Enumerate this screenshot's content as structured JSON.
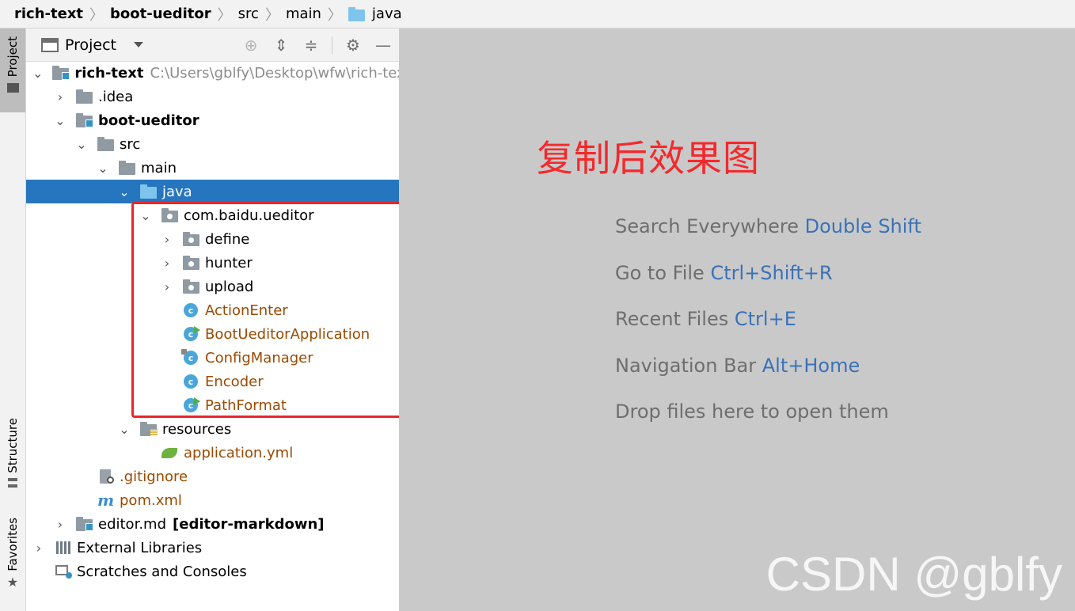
{
  "breadcrumb": {
    "items": [
      "rich-text",
      "boot-ueditor",
      "src",
      "main",
      "java"
    ]
  },
  "toolstrip": {
    "project_label": "Project",
    "structure_label": "Structure",
    "favorites_label": "Favorites"
  },
  "panel": {
    "title": "Project"
  },
  "tree": {
    "root_name": "rich-text",
    "root_path": "C:\\Users\\gblfy\\Desktop\\wfw\\rich-text",
    "idea": ".idea",
    "module": "boot-ueditor",
    "src": "src",
    "main": "main",
    "java": "java",
    "package": "com.baidu.ueditor",
    "pkg_define": "define",
    "pkg_hunter": "hunter",
    "pkg_upload": "upload",
    "cls_action": "ActionEnter",
    "cls_boot": "BootUeditorApplication",
    "cls_config": "ConfigManager",
    "cls_encoder": "Encoder",
    "cls_path": "PathFormat",
    "resources": "resources",
    "app_yml": "application.yml",
    "gitignore": ".gitignore",
    "pom": "pom.xml",
    "editor_md": "editor.md",
    "editor_md_module": "[editor-markdown]",
    "ext_libs": "External Libraries",
    "scratches": "Scratches and Consoles"
  },
  "editor": {
    "overlay_title": "复制后效果图",
    "hints": [
      {
        "text": "Search Everywhere",
        "shortcut": "Double Shift"
      },
      {
        "text": "Go to File",
        "shortcut": "Ctrl+Shift+R"
      },
      {
        "text": "Recent Files",
        "shortcut": "Ctrl+E"
      },
      {
        "text": "Navigation Bar",
        "shortcut": "Alt+Home"
      },
      {
        "text": "Drop files here to open them",
        "shortcut": ""
      }
    ],
    "watermark": "CSDN @gblfy"
  },
  "colors": {
    "selection": "#2675bf",
    "highlight_box": "#e8262a",
    "shortcut": "#3a72b8"
  }
}
